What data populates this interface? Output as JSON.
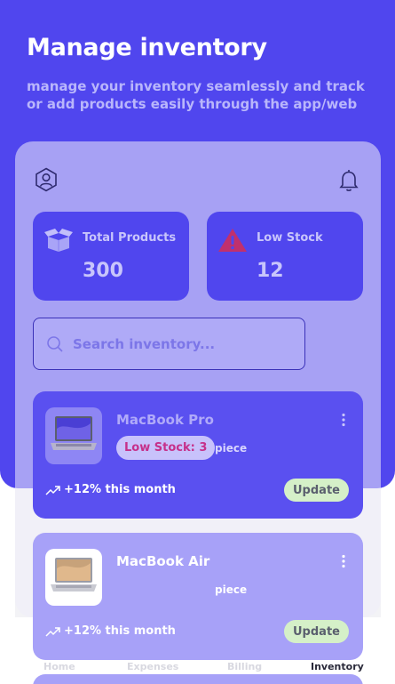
{
  "hero": {
    "title": "Manage inventory",
    "subtitle": "manage your inventory seamlessly and track or add products easily through the app/web"
  },
  "header": {
    "profile_icon": "user-hexagon-icon",
    "notification_icon": "bell-icon"
  },
  "stats": [
    {
      "label": "Total Products",
      "value": "300",
      "icon": "open-box-icon"
    },
    {
      "label": "Low Stock",
      "value": "12",
      "icon": "warning-triangle-icon"
    }
  ],
  "search": {
    "placeholder": "Search inventory..."
  },
  "products": [
    {
      "name": "MacBook Pro",
      "badge": "Low Stock: 3",
      "unit": "piece",
      "trend": "+12% this month",
      "action": "Update"
    },
    {
      "name": "MacBook Air",
      "badge": "",
      "unit": "piece",
      "trend": "+12% this month",
      "action": "Update"
    }
  ],
  "tabs": [
    {
      "label": "Home"
    },
    {
      "label": "Expenses"
    },
    {
      "label": "Billing"
    },
    {
      "label": "Inventory",
      "active": true
    }
  ],
  "colors": {
    "primary": "#5046ee",
    "accent_light": "#c8c5fb",
    "warning": "#c6308a",
    "update_button": "#d5f0c8"
  }
}
